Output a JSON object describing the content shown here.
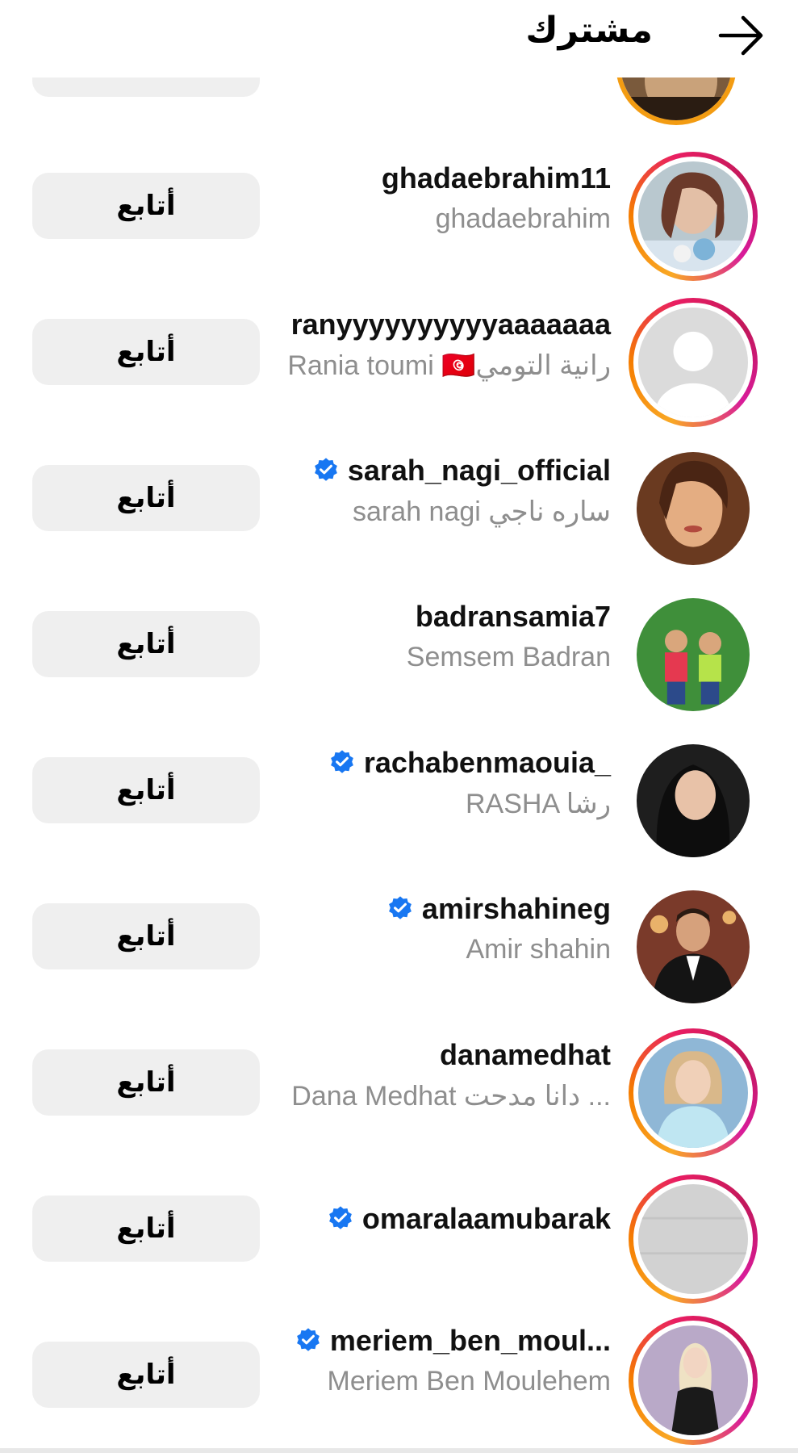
{
  "header": {
    "title": "مشترك",
    "back_icon": "arrow-right-icon"
  },
  "colors": {
    "story_ring": "#e91e63",
    "verified": "#1877f2",
    "button_bg": "#efefef",
    "secondary_text": "#8e8e8e"
  },
  "users": [
    {
      "username": "ghadaebrahim11",
      "full_name": "ghadaebrahim",
      "verified": false,
      "story": true,
      "follow_label": "أتابع"
    },
    {
      "username": "ranyyyyyyyyyyaaaaaaa",
      "full_name": "Rania toumi 🇹🇳رانية التومي",
      "verified": false,
      "story": true,
      "follow_label": "أتابع"
    },
    {
      "username": "sarah_nagi_official",
      "full_name": "sarah nagi ساره ناجي",
      "verified": true,
      "story": false,
      "follow_label": "أتابع"
    },
    {
      "username": "badransamia7",
      "full_name": "Semsem Badran",
      "verified": false,
      "story": false,
      "follow_label": "أتابع"
    },
    {
      "username": "rachabenmaouia_",
      "full_name": "RASHA رشا",
      "verified": true,
      "story": false,
      "follow_label": "أتابع"
    },
    {
      "username": "amirshahineg",
      "full_name": "Amir shahin",
      "verified": true,
      "story": false,
      "follow_label": "أتابع"
    },
    {
      "username": "danamedhat",
      "full_name": "Dana Medhat دانا مدحت ...",
      "verified": false,
      "story": true,
      "follow_label": "أتابع"
    },
    {
      "username": "omaralaamubarak",
      "full_name": "",
      "verified": true,
      "story": true,
      "follow_label": "أتابع"
    },
    {
      "username": "meriem_ben_moul...",
      "full_name": "Meriem Ben Moulehem",
      "verified": true,
      "story": true,
      "follow_label": "أتابع"
    }
  ]
}
